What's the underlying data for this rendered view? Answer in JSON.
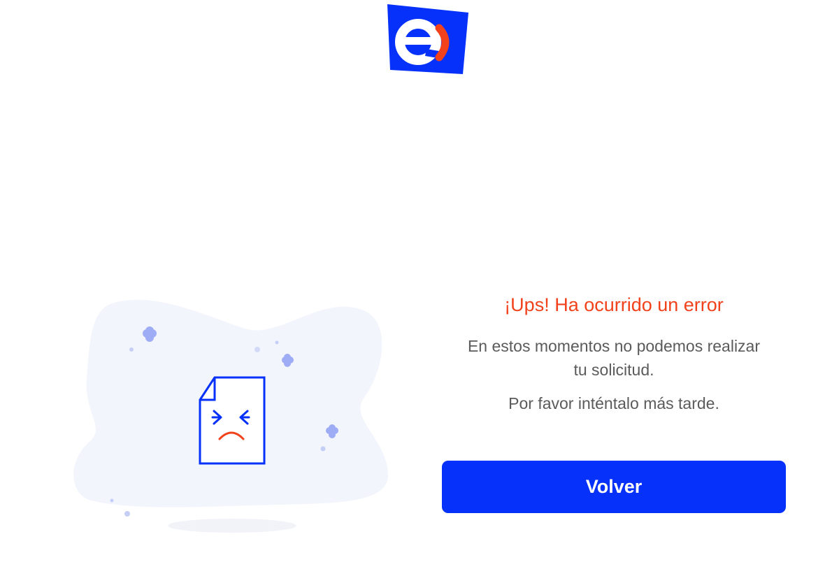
{
  "brand": {
    "logo_icon": "entel-logo",
    "primary_color": "#0531fb",
    "accent_color": "#f2421c"
  },
  "error": {
    "title": "¡Ups! Ha ocurrido un error",
    "description": "En estos momentos no podemos realizar tu solicitud.",
    "retry_hint": "Por favor inténtalo más tarde."
  },
  "actions": {
    "back_label": "Volver"
  },
  "illustration": {
    "icon": "sad-document-icon"
  }
}
